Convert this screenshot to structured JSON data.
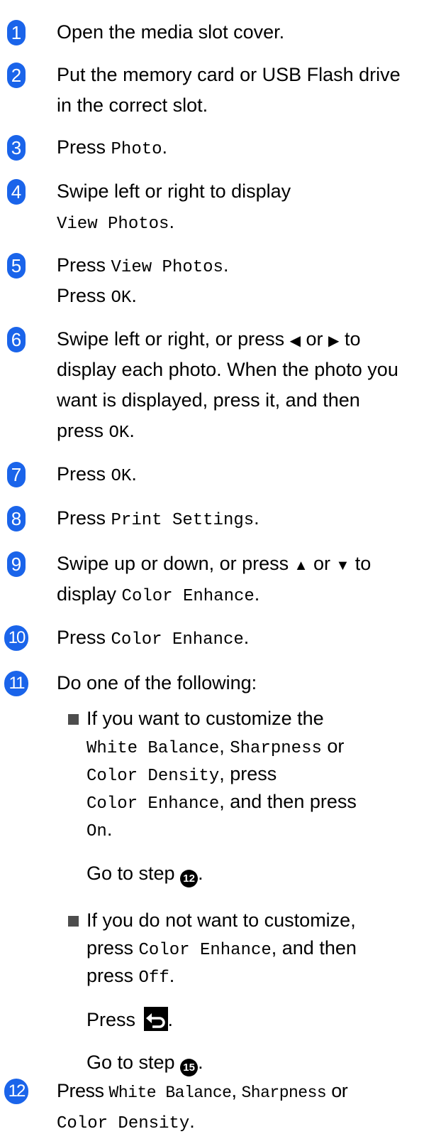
{
  "steps": {
    "s1": {
      "num": "1",
      "text": "Open the media slot cover."
    },
    "s2": {
      "num": "2",
      "line1": "Put the memory card or USB Flash drive",
      "line2": "in the correct slot."
    },
    "s3": {
      "num": "3",
      "pre": "Press ",
      "code": "Photo",
      "post": "."
    },
    "s4": {
      "num": "4",
      "line1": "Swipe left or right to display",
      "code": "View Photos",
      "post": "."
    },
    "s5": {
      "num": "5",
      "pre": "Press ",
      "code": "View Photos",
      "post": ".",
      "pre2": "Press ",
      "code2": "OK",
      "post2": "."
    },
    "s6": {
      "num": "6",
      "line1a": "Swipe left or right, or press ",
      "left_arrow": "◀",
      "line1b": " or ",
      "right_arrow": "▶",
      "line1c": " to",
      "line2": "display each photo. When the photo you",
      "line3": "want is displayed, press it, and then",
      "line4pre": "press ",
      "line4code": "OK",
      "line4post": "."
    },
    "s7": {
      "num": "7",
      "pre": "Press ",
      "code": "OK",
      "post": "."
    },
    "s8": {
      "num": "8",
      "pre": "Press ",
      "code": "Print Settings",
      "post": "."
    },
    "s9": {
      "num": "9",
      "line1a": "Swipe up or down, or press ",
      "up_arrow": "▲",
      "line1b": " or ",
      "down_arrow": "▼",
      "line1c": " to",
      "line2pre": "display ",
      "line2code": "Color Enhance",
      "line2post": "."
    },
    "s10": {
      "num": "10",
      "pre": "Press ",
      "code": "Color Enhance",
      "post": "."
    },
    "s11": {
      "num": "11",
      "text": "Do one of the following:",
      "b1": {
        "line1": "If you want to customize the",
        "l2code1": "White Balance",
        "l2sep": ", ",
        "l2code2": "Sharpness",
        "l2or": " or",
        "l3code": "Color Density",
        "l3post": ", press",
        "l4code": "Color Enhance",
        "l4post": ", and then press",
        "l5code": "On",
        "l5post": ".",
        "goto_pre": "Go to step ",
        "goto_ref": "12",
        "goto_post": "."
      },
      "b2": {
        "line1": "If you do not want to customize,",
        "l2pre": "press ",
        "l2code": "Color Enhance",
        "l2post": ", and then",
        "l3pre": "press ",
        "l3code": "Off",
        "l3post": ".",
        "press_label": "Press ",
        "press_post": ".",
        "goto_pre": "Go to step ",
        "goto_ref": "15",
        "goto_post": "."
      }
    },
    "s12": {
      "num": "12",
      "pre": "Press ",
      "code1": "White Balance",
      "sep": ", ",
      "code2": "Sharpness",
      "or": " or",
      "l2code": "Color Density",
      "l2post": "."
    }
  }
}
